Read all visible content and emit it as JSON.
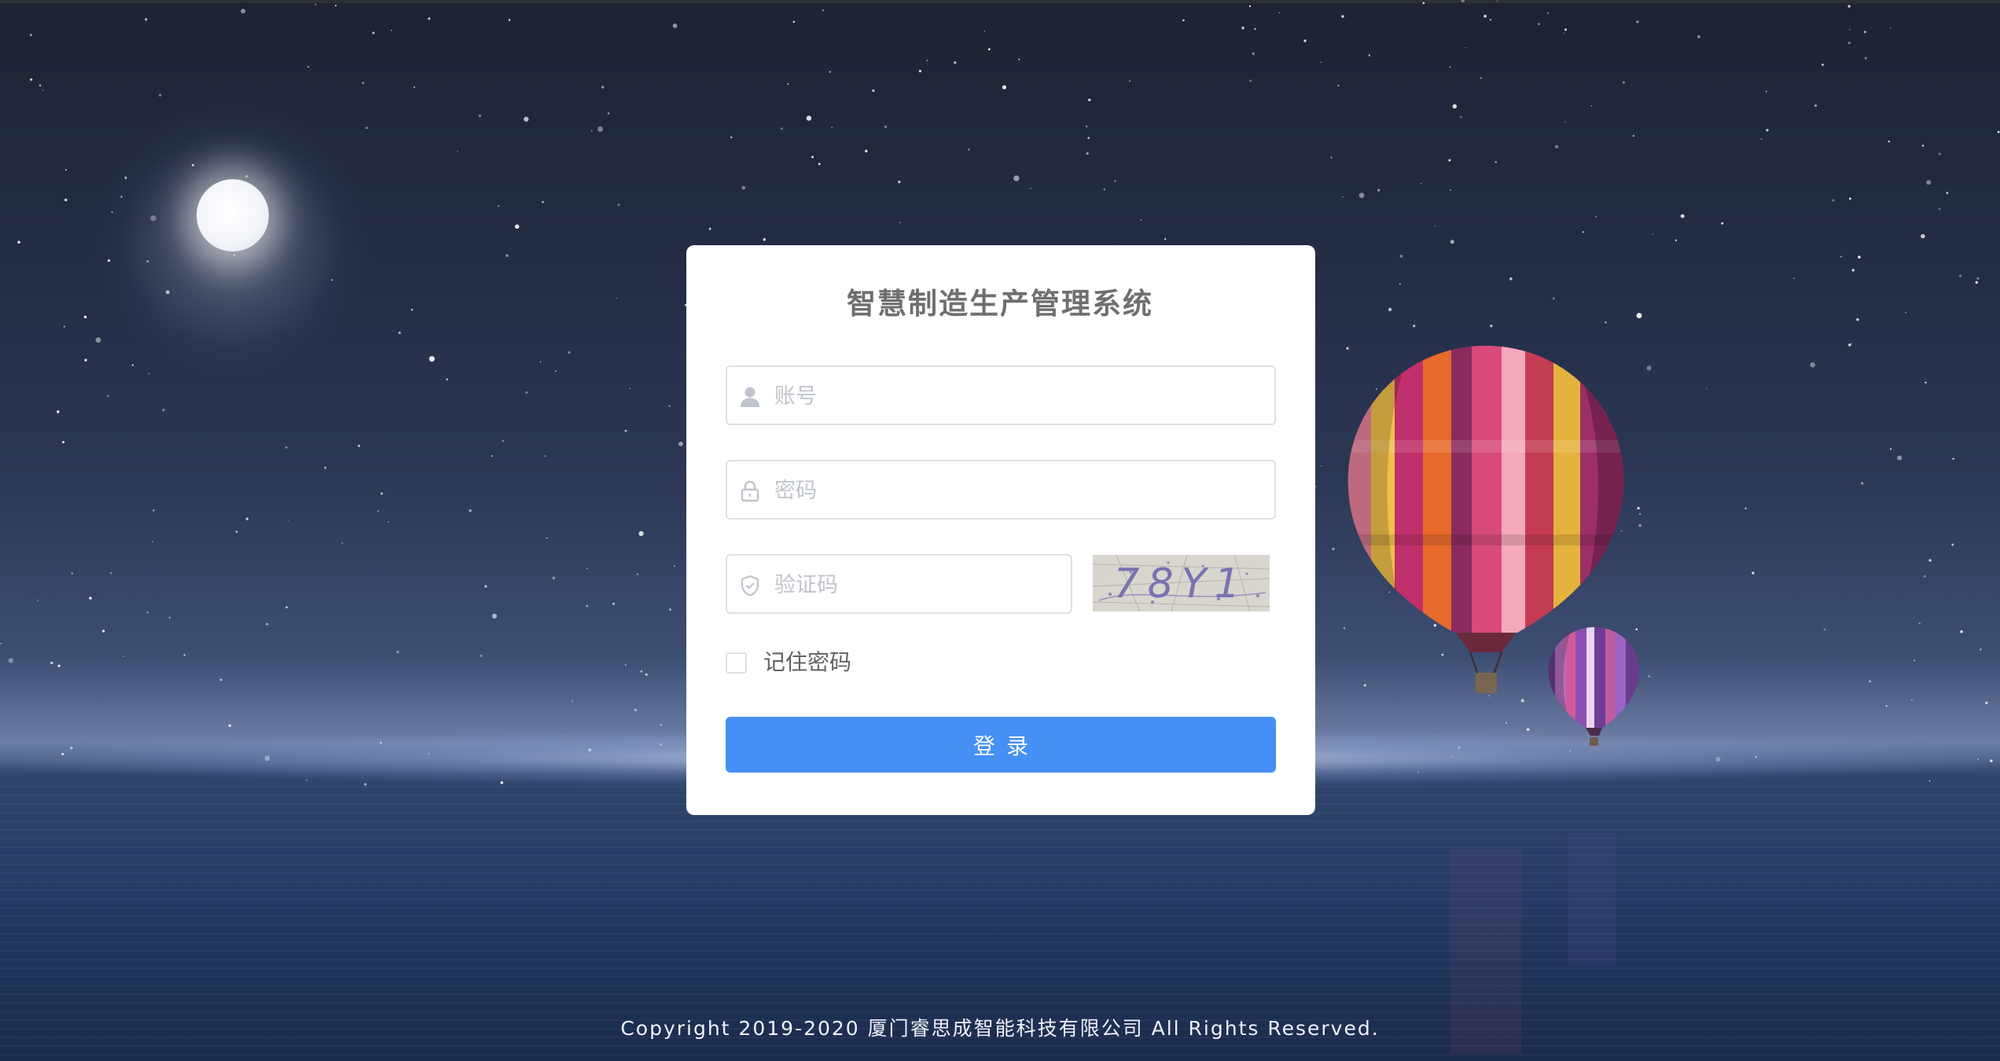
{
  "login": {
    "title": "智慧制造生产管理系统",
    "username_placeholder": "账号",
    "password_placeholder": "密码",
    "captcha_placeholder": "验证码",
    "captcha_text": "78Y1",
    "remember_label": "记住密码",
    "remember_checked": false,
    "submit_label": "登录"
  },
  "footer": {
    "copyright": "Copyright 2019-2020 厦门睿思成智能科技有限公司 All Rights Reserved."
  },
  "icons": {
    "username": "user-icon",
    "password": "lock-icon",
    "captcha": "shield-icon"
  },
  "colors": {
    "primary": "#4590f5",
    "card_background": "#ffffff",
    "title_text": "#6f6f72",
    "placeholder": "#c0c4cc",
    "input_border": "#dcdfe6"
  }
}
